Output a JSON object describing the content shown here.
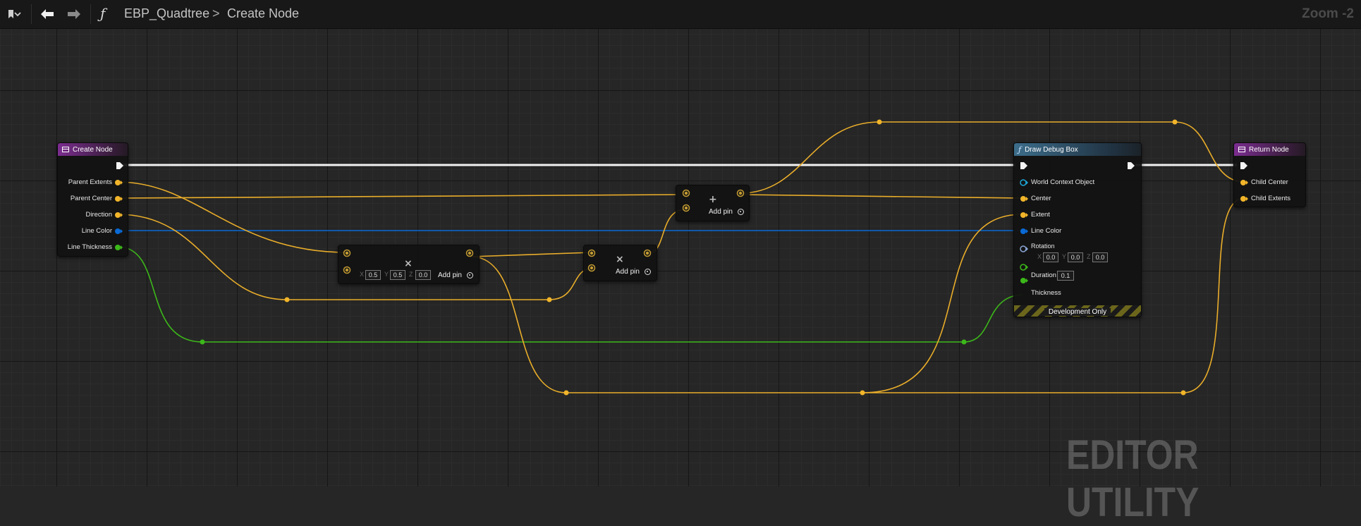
{
  "toolbar": {
    "bookmark_icon": "bookmark-icon",
    "back_icon": "arrow-left-icon",
    "forward_icon": "arrow-right-icon",
    "function_icon_glyph": "ƒ",
    "blueprint_name": "EBP_Quadtree",
    "breadcrumb_separator": ">",
    "function_name": "Create Node",
    "zoom_label": "Zoom -2"
  },
  "nodes": {
    "create_node": {
      "title": "Create Node",
      "pins": [
        "Parent Extents",
        "Parent Center",
        "Direction",
        "Line Color",
        "Line Thickness"
      ]
    },
    "multiply_node": {
      "x": "0.5",
      "y": "0.5",
      "z": "0.0",
      "axis_x": "X",
      "axis_y": "Y",
      "axis_z": "Z",
      "add_pin": "Add pin"
    },
    "multiply_node_2": {
      "add_pin": "Add pin"
    },
    "add_node": {
      "add_pin": "Add pin"
    },
    "draw_debug_box": {
      "title": "Draw Debug Box",
      "pins": {
        "world_context": "World Context Object",
        "center": "Center",
        "extent": "Extent",
        "line_color": "Line Color",
        "rotation": "Rotation",
        "duration": "Duration",
        "thickness": "Thickness"
      },
      "rotation": {
        "x": "0.0",
        "y": "0.0",
        "z": "0.0",
        "axis_x": "X",
        "axis_y": "Y",
        "axis_z": "Z"
      },
      "duration_value": "0.1",
      "footer": "Development Only"
    },
    "return_node": {
      "title": "Return Node",
      "pins": [
        "Child Center",
        "Child Extents"
      ]
    }
  },
  "colors": {
    "exec_wire": "#ffffff",
    "vector_wire": "#f2b52a",
    "color_wire": "#0a6ad6",
    "float_wire": "#44c21b",
    "object_pin": "#1ea6d8"
  },
  "watermark": "EDITOR UTILITY"
}
